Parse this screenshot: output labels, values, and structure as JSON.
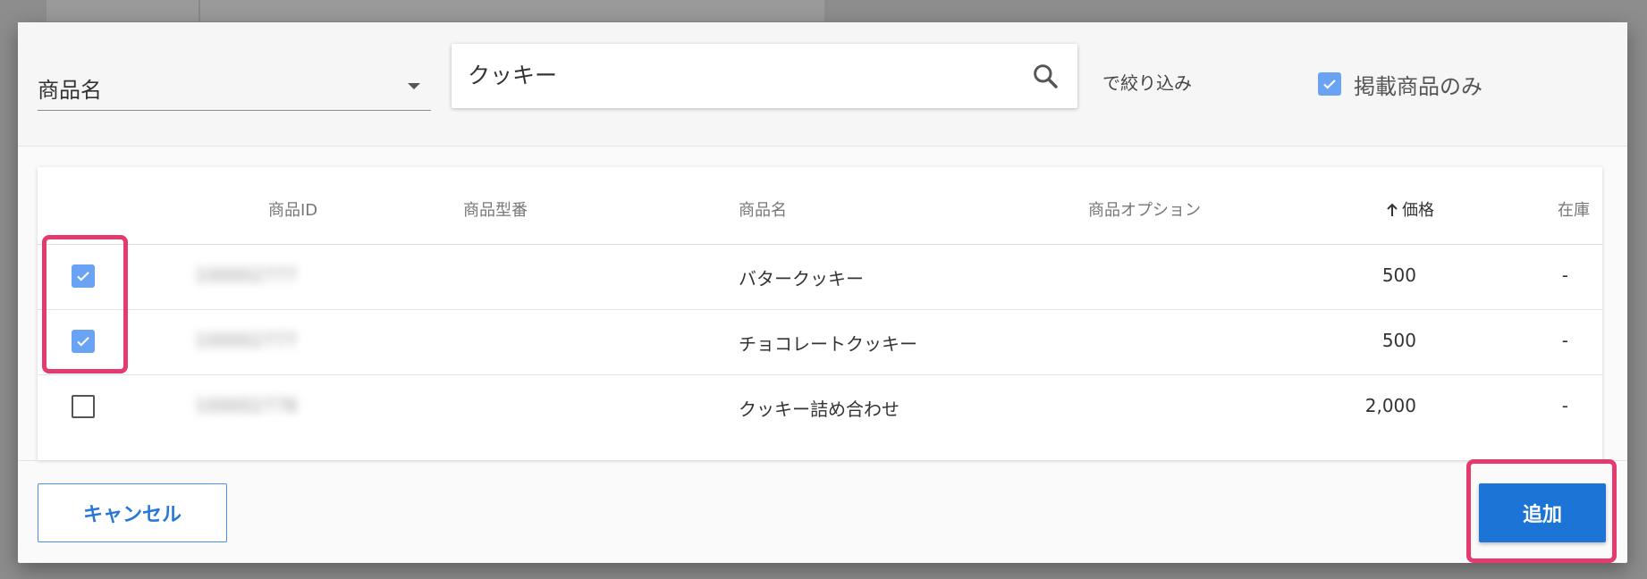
{
  "filter": {
    "field_select_label": "商品名",
    "search_value": "クッキー",
    "search_placeholder": "",
    "suffix_text": "で絞り込み",
    "only_listed_label": "掲載商品のみ",
    "only_listed_checked": true
  },
  "table": {
    "headers": {
      "id": "商品ID",
      "model": "商品型番",
      "name": "商品名",
      "option": "商品オプション",
      "price": "価格",
      "stock": "在庫"
    },
    "sort": {
      "column": "price",
      "direction": "ascending"
    },
    "rows": [
      {
        "checked": true,
        "id": "100002777",
        "model": "",
        "name": "バタークッキー",
        "option": "",
        "price": "500",
        "stock": "-"
      },
      {
        "checked": true,
        "id": "100002777",
        "model": "",
        "name": "チョコレートクッキー",
        "option": "",
        "price": "500",
        "stock": "-"
      },
      {
        "checked": false,
        "id": "100002778",
        "model": "",
        "name": "クッキー詰め合わせ",
        "option": "",
        "price": "2,000",
        "stock": "-"
      }
    ]
  },
  "footer": {
    "cancel_label": "キャンセル",
    "add_label": "追加"
  },
  "colors": {
    "accent": "#1c74d6",
    "checkbox": "#6aa3f3",
    "highlight": "#e43a6d"
  }
}
